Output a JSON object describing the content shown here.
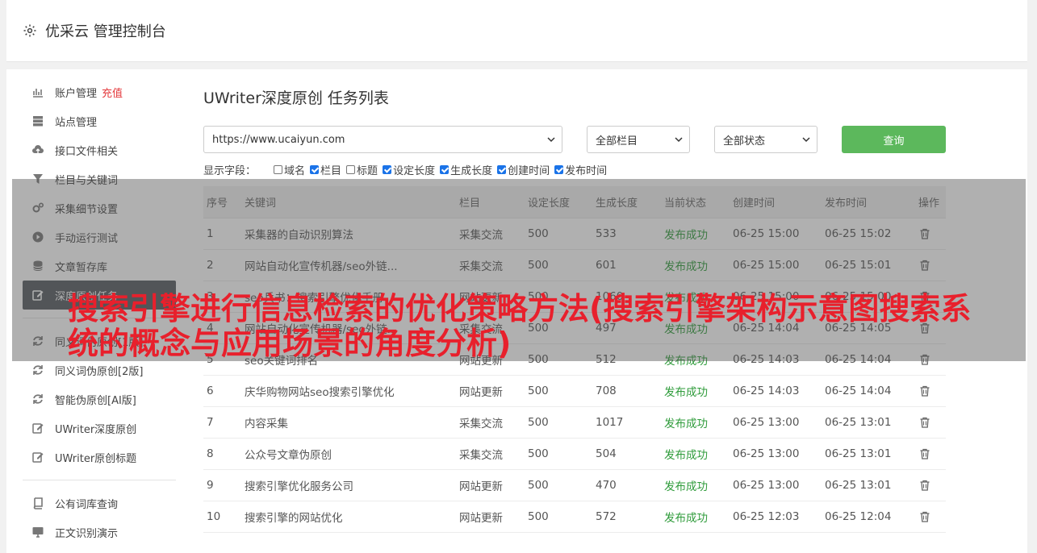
{
  "header": {
    "title": "优采云 管理控制台"
  },
  "sidebar": {
    "items": [
      {
        "label": "账户管理",
        "extra": "充值",
        "icon": "bar-chart-icon"
      },
      {
        "label": "站点管理",
        "icon": "server-icon"
      },
      {
        "label": "接口文件相关",
        "icon": "cloud-upload-icon"
      },
      {
        "label": "栏目与关键词",
        "icon": "filter-icon"
      },
      {
        "label": "采集细节设置",
        "icon": "gears-icon"
      },
      {
        "label": "手动运行测试",
        "icon": "play-circle-icon"
      },
      {
        "label": "文章暂存库",
        "icon": "database-icon"
      },
      {
        "label": "深度原创任务",
        "icon": "edit-icon",
        "active": true
      },
      {
        "label": "同义词伪原创[1版]",
        "icon": "refresh-icon"
      },
      {
        "label": "同义词伪原创[2版]",
        "icon": "refresh-icon"
      },
      {
        "label": "智能伪原创[AI版]",
        "icon": "refresh-icon"
      },
      {
        "label": "UWriter深度原创",
        "icon": "edit-icon"
      },
      {
        "label": "UWriter原创标题",
        "icon": "edit-icon"
      },
      {
        "label": "公有词库查询",
        "icon": "book-icon"
      },
      {
        "label": "正文识别演示",
        "icon": "monitor-icon"
      }
    ]
  },
  "main": {
    "title": "UWriter深度原创 任务列表",
    "site_select": "https://www.ucaiyun.com",
    "column_select": "全部栏目",
    "status_select": "全部状态",
    "query_label": "查询",
    "fields_label": "显示字段：",
    "fields": [
      {
        "label": "域名",
        "checked": false
      },
      {
        "label": "栏目",
        "checked": true
      },
      {
        "label": "标题",
        "checked": false
      },
      {
        "label": "设定长度",
        "checked": true
      },
      {
        "label": "生成长度",
        "checked": true
      },
      {
        "label": "创建时间",
        "checked": true
      },
      {
        "label": "发布时间",
        "checked": true
      }
    ],
    "table": {
      "headers": [
        "序号",
        "关键词",
        "栏目",
        "设定长度",
        "生成长度",
        "当前状态",
        "创建时间",
        "发布时间",
        "操作"
      ],
      "rows": [
        [
          "1",
          "采集器的自动识别算法",
          "采集交流",
          "500",
          "533",
          "发布成功",
          "06-25 15:00",
          "06-25 15:02"
        ],
        [
          "2",
          "网站自动化宣传机器/seo外链...",
          "采集交流",
          "500",
          "601",
          "发布成功",
          "06-25 15:00",
          "06-25 15:01"
        ],
        [
          "3",
          "seo兵书：搜索引擎优化手册",
          "网站更新",
          "500",
          "1060",
          "发布成功",
          "06-25 15:00",
          "06-25 15:00"
        ],
        [
          "4",
          "网站自动化宣传机器/seo外链...",
          "采集交流",
          "500",
          "497",
          "发布成功",
          "06-25 14:04",
          "06-25 14:05"
        ],
        [
          "5",
          "seo关键词排名",
          "网站更新",
          "500",
          "512",
          "发布成功",
          "06-25 14:03",
          "06-25 14:04"
        ],
        [
          "6",
          "庆华购物网站seo搜索引擎优化",
          "网站更新",
          "500",
          "708",
          "发布成功",
          "06-25 14:03",
          "06-25 14:04"
        ],
        [
          "7",
          "内容采集",
          "采集交流",
          "500",
          "1017",
          "发布成功",
          "06-25 13:00",
          "06-25 13:01"
        ],
        [
          "8",
          "公众号文章伪原创",
          "采集交流",
          "500",
          "504",
          "发布成功",
          "06-25 13:00",
          "06-25 13:01"
        ],
        [
          "9",
          "搜索引擎优化服务公司",
          "网站更新",
          "500",
          "470",
          "发布成功",
          "06-25 13:00",
          "06-25 13:01"
        ],
        [
          "10",
          "搜索引擎的网站优化",
          "网站更新",
          "500",
          "572",
          "发布成功",
          "06-25 12:03",
          "06-25 12:04"
        ]
      ]
    }
  },
  "overlay": {
    "headline": "搜索引擎进行信息检索的优化策略方法(搜索引擎架构示意图搜索系统的概念与应用场景的角度分析)"
  },
  "colors": {
    "accent_green": "#5cb85c",
    "status_ok": "#2e9b3a",
    "headline_red": "#e8202c",
    "active_nav": "#555a60"
  }
}
